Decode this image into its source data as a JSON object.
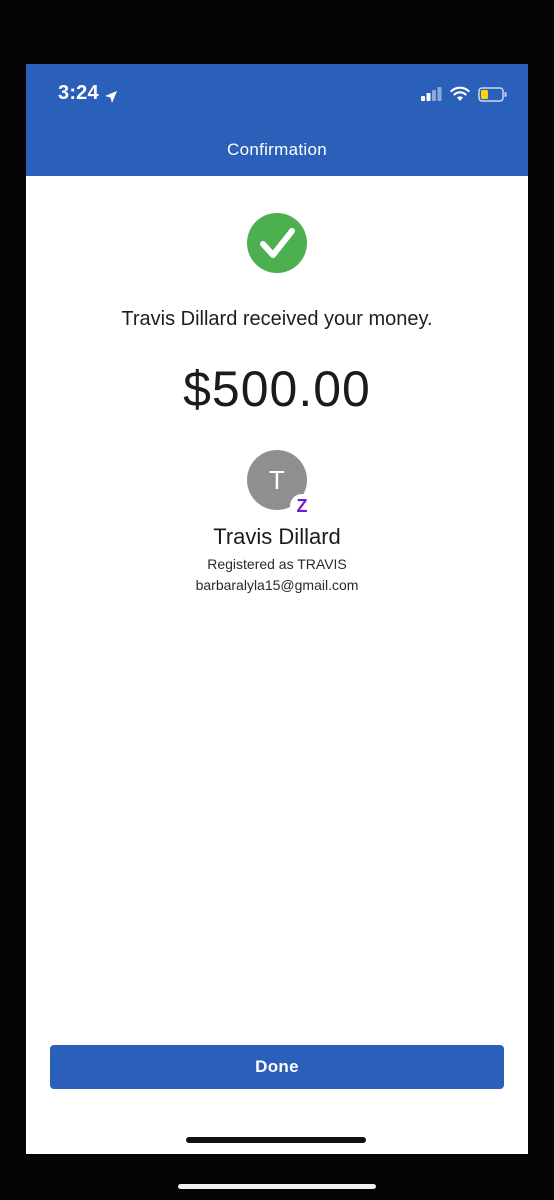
{
  "status_bar": {
    "time": "3:24",
    "location_icon": "location-arrow-icon",
    "signal_icon": "cellular-signal-icon",
    "wifi_icon": "wifi-icon",
    "battery_icon": "battery-low-icon"
  },
  "header": {
    "title": "Confirmation"
  },
  "confirmation": {
    "check_icon": "check-circle-icon",
    "message": "Travis Dillard received your money.",
    "amount": "$500.00"
  },
  "recipient": {
    "avatar_initial": "T",
    "badge_icon": "zelle-icon",
    "badge_glyph": "Z",
    "name": "Travis Dillard",
    "registered_as": "Registered as TRAVIS",
    "email": "barbaralyla15@gmail.com"
  },
  "actions": {
    "done_label": "Done"
  },
  "colors": {
    "brand_blue": "#2a5fba",
    "success_green": "#4caf50",
    "avatar_gray": "#8f8f8f",
    "zelle_purple": "#6d1ed4"
  }
}
